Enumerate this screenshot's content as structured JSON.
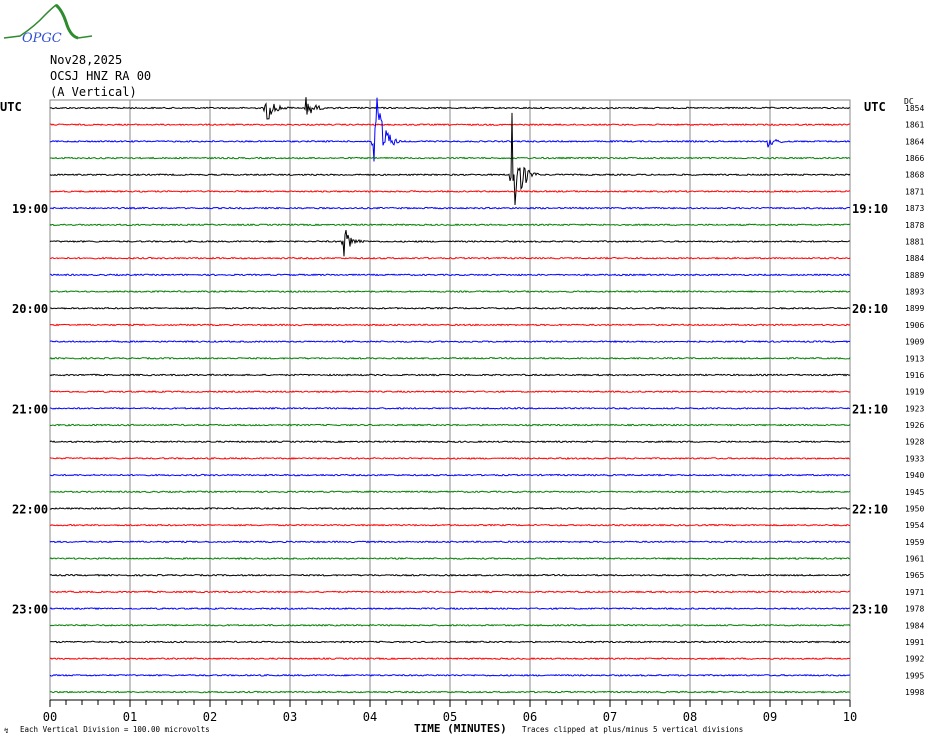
{
  "header": {
    "logo_text": "OPGC",
    "date": "Nov28,2025",
    "station": "OCSJ HNZ RA 00",
    "component": "(A Vertical)"
  },
  "left_label": "UTC",
  "right_label": "UTC",
  "dc_label": "DC",
  "footer": {
    "scale_note": "Each Vertical Division =  100.00 microvolts",
    "xlabel": "TIME (MINUTES)",
    "clip_note": "Traces clipped at plus/minus 5 vertical divisions"
  },
  "chart_data": {
    "type": "line",
    "xlabel": "TIME (MINUTES)",
    "xlim": [
      0,
      10
    ],
    "x_ticks": [
      "00",
      "01",
      "02",
      "03",
      "04",
      "05",
      "06",
      "07",
      "08",
      "09",
      "10"
    ],
    "grid": true,
    "trace_colors": [
      "#000000",
      "#ff0000",
      "#0000ff",
      "#008000"
    ],
    "left_hour_labels": [
      {
        "row": 6,
        "label": "19:00"
      },
      {
        "row": 12,
        "label": "20:00"
      },
      {
        "row": 18,
        "label": "21:00"
      },
      {
        "row": 24,
        "label": "22:00"
      },
      {
        "row": 30,
        "label": "23:00"
      }
    ],
    "right_hour_labels": [
      {
        "row": 6,
        "label": "19:10"
      },
      {
        "row": 12,
        "label": "20:10"
      },
      {
        "row": 18,
        "label": "21:10"
      },
      {
        "row": 24,
        "label": "22:10"
      },
      {
        "row": 30,
        "label": "23:10"
      }
    ],
    "dc_offsets": [
      1854,
      1861,
      1864,
      1866,
      1868,
      1871,
      1873,
      1878,
      1881,
      1884,
      1889,
      1893,
      1899,
      1906,
      1909,
      1913,
      1916,
      1919,
      1923,
      1926,
      1928,
      1933,
      1940,
      1945,
      1950,
      1954,
      1959,
      1961,
      1965,
      1971,
      1978,
      1984,
      1991,
      1992,
      1995,
      1998
    ],
    "events": [
      {
        "row": 0,
        "minute": 2.7,
        "amplitude": 1.0
      },
      {
        "row": 0,
        "minute": 3.2,
        "amplitude": 0.7
      },
      {
        "row": 2,
        "minute": 4.05,
        "amplitude": 5
      },
      {
        "row": 2,
        "minute": 8.97,
        "amplitude": 0.4
      },
      {
        "row": 4,
        "minute": 5.77,
        "amplitude": 5
      },
      {
        "row": 8,
        "minute": 3.67,
        "amplitude": 1.0
      }
    ]
  }
}
